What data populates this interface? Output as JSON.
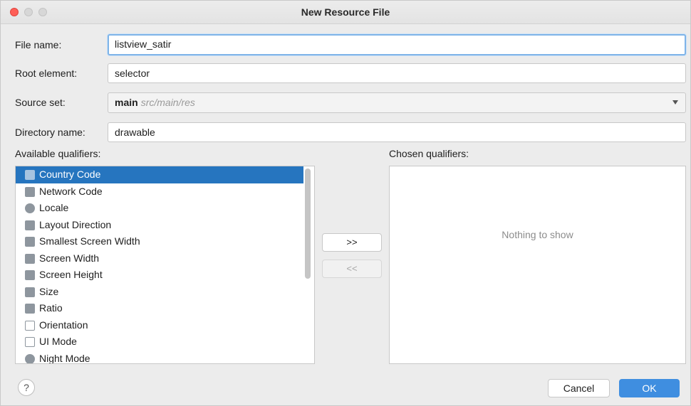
{
  "window": {
    "title": "New Resource File"
  },
  "form": {
    "file_name_label": "File name:",
    "file_name_value": "listview_satir",
    "root_element_label": "Root element:",
    "root_element_value": "selector",
    "source_set_label": "Source set:",
    "source_set_value": "main",
    "source_set_path": "src/main/res",
    "directory_name_label": "Directory name:",
    "directory_name_value": "drawable"
  },
  "qualifiers": {
    "available_label": "Available qualifiers:",
    "chosen_label": "Chosen qualifiers:",
    "empty_text": "Nothing to show",
    "add_label": ">>",
    "remove_label": "<<",
    "items": [
      {
        "label": "Country Code",
        "icon": "country-code-icon",
        "selected": true
      },
      {
        "label": "Network Code",
        "icon": "network-code-icon",
        "selected": false
      },
      {
        "label": "Locale",
        "icon": "globe-icon",
        "selected": false
      },
      {
        "label": "Layout Direction",
        "icon": "layout-direction-icon",
        "selected": false
      },
      {
        "label": "Smallest Screen Width",
        "icon": "smallest-screen-width-icon",
        "selected": false
      },
      {
        "label": "Screen Width",
        "icon": "screen-width-icon",
        "selected": false
      },
      {
        "label": "Screen Height",
        "icon": "screen-height-icon",
        "selected": false
      },
      {
        "label": "Size",
        "icon": "size-icon",
        "selected": false
      },
      {
        "label": "Ratio",
        "icon": "ratio-icon",
        "selected": false
      },
      {
        "label": "Orientation",
        "icon": "orientation-icon",
        "selected": false
      },
      {
        "label": "UI Mode",
        "icon": "ui-mode-icon",
        "selected": false
      },
      {
        "label": "Night Mode",
        "icon": "night-mode-icon",
        "selected": false
      }
    ]
  },
  "footer": {
    "help_label": "?",
    "cancel_label": "Cancel",
    "ok_label": "OK"
  },
  "colors": {
    "selection": "#2675bf",
    "ok_button": "#3f8ee0",
    "focus_ring": "#7fb4e8"
  }
}
